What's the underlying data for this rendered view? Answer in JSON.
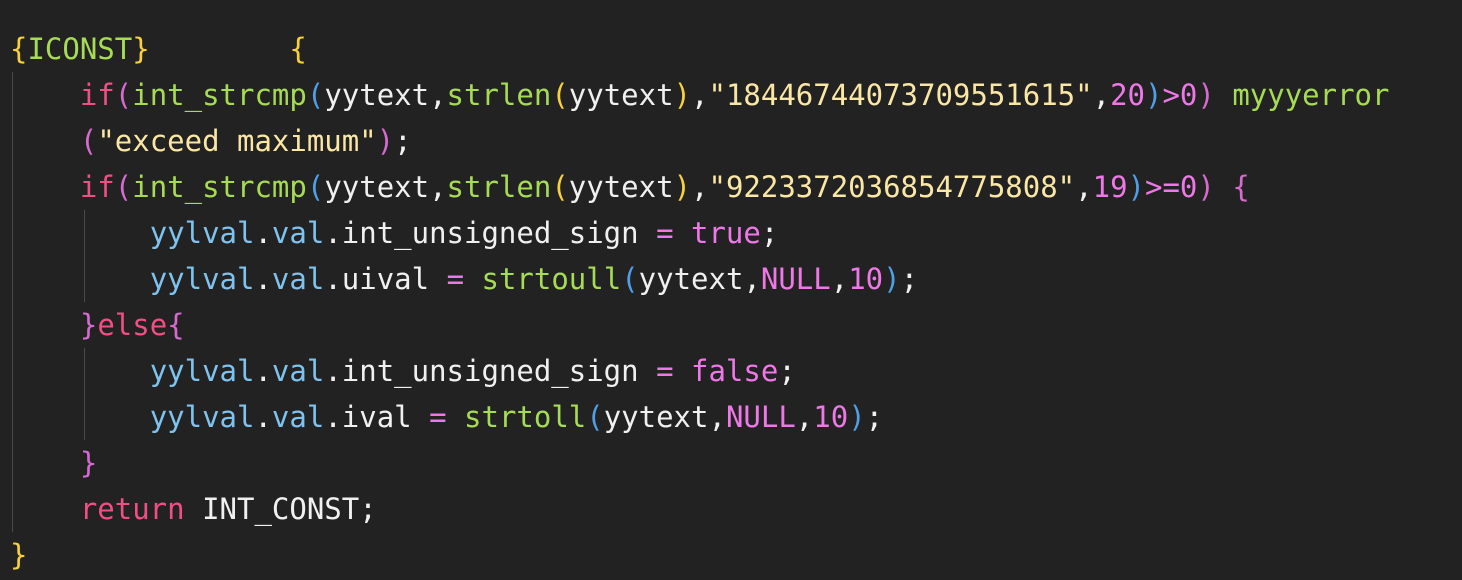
{
  "theme": {
    "background": "#222222",
    "plain": "#f0f0f0",
    "keyword": "#f14e84",
    "function": "#a6dc54",
    "string": "#fbe7a5",
    "number": "#ee78e7",
    "operator": "#ee78e7",
    "variable": "#7ec3f0",
    "identifier": "#f0f0f0",
    "brace_gold": "#f8d13a",
    "brace_pink": "#d66ad0",
    "brace_blue": "#4f9ee8",
    "rule_name": "#a6dc54"
  },
  "code_lines": [
    [
      {
        "t": "{",
        "c": "brace_gold"
      },
      {
        "t": "ICONST",
        "c": "rule_name"
      },
      {
        "t": "}",
        "c": "brace_gold"
      },
      {
        "t": "        ",
        "c": "plain"
      },
      {
        "t": "{",
        "c": "brace_gold"
      }
    ],
    [
      {
        "t": "    ",
        "c": "plain"
      },
      {
        "t": "if",
        "c": "keyword"
      },
      {
        "t": "(",
        "c": "brace_pink"
      },
      {
        "t": "int_strcmp",
        "c": "function"
      },
      {
        "t": "(",
        "c": "brace_blue"
      },
      {
        "t": "yytext",
        "c": "plain"
      },
      {
        "t": ",",
        "c": "plain"
      },
      {
        "t": "strlen",
        "c": "function"
      },
      {
        "t": "(",
        "c": "brace_gold"
      },
      {
        "t": "yytext",
        "c": "plain"
      },
      {
        "t": ")",
        "c": "brace_gold"
      },
      {
        "t": ",",
        "c": "plain"
      },
      {
        "t": "\"18446744073709551615\"",
        "c": "string"
      },
      {
        "t": ",",
        "c": "plain"
      },
      {
        "t": "20",
        "c": "number"
      },
      {
        "t": ")",
        "c": "brace_blue"
      },
      {
        "t": ">",
        "c": "operator"
      },
      {
        "t": "0",
        "c": "number"
      },
      {
        "t": ")",
        "c": "brace_pink"
      },
      {
        "t": " ",
        "c": "plain"
      },
      {
        "t": "myyyerror",
        "c": "function"
      }
    ],
    [
      {
        "t": "    ",
        "c": "plain"
      },
      {
        "t": "(",
        "c": "brace_pink"
      },
      {
        "t": "\"exceed maximum\"",
        "c": "string"
      },
      {
        "t": ")",
        "c": "brace_pink"
      },
      {
        "t": ";",
        "c": "plain"
      }
    ],
    [
      {
        "t": "    ",
        "c": "plain"
      },
      {
        "t": "if",
        "c": "keyword"
      },
      {
        "t": "(",
        "c": "brace_pink"
      },
      {
        "t": "int_strcmp",
        "c": "function"
      },
      {
        "t": "(",
        "c": "brace_blue"
      },
      {
        "t": "yytext",
        "c": "plain"
      },
      {
        "t": ",",
        "c": "plain"
      },
      {
        "t": "strlen",
        "c": "function"
      },
      {
        "t": "(",
        "c": "brace_gold"
      },
      {
        "t": "yytext",
        "c": "plain"
      },
      {
        "t": ")",
        "c": "brace_gold"
      },
      {
        "t": ",",
        "c": "plain"
      },
      {
        "t": "\"9223372036854775808\"",
        "c": "string"
      },
      {
        "t": ",",
        "c": "plain"
      },
      {
        "t": "19",
        "c": "number"
      },
      {
        "t": ")",
        "c": "brace_blue"
      },
      {
        "t": ">=",
        "c": "operator"
      },
      {
        "t": "0",
        "c": "number"
      },
      {
        "t": ")",
        "c": "brace_pink"
      },
      {
        "t": " ",
        "c": "plain"
      },
      {
        "t": "{",
        "c": "brace_pink"
      }
    ],
    [
      {
        "t": "        ",
        "c": "plain"
      },
      {
        "t": "yylval",
        "c": "variable"
      },
      {
        "t": ".",
        "c": "plain"
      },
      {
        "t": "val",
        "c": "variable"
      },
      {
        "t": ".",
        "c": "plain"
      },
      {
        "t": "int_unsigned_sign",
        "c": "plain"
      },
      {
        "t": " ",
        "c": "plain"
      },
      {
        "t": "=",
        "c": "operator"
      },
      {
        "t": " ",
        "c": "plain"
      },
      {
        "t": "true",
        "c": "number"
      },
      {
        "t": ";",
        "c": "plain"
      }
    ],
    [
      {
        "t": "        ",
        "c": "plain"
      },
      {
        "t": "yylval",
        "c": "variable"
      },
      {
        "t": ".",
        "c": "plain"
      },
      {
        "t": "val",
        "c": "variable"
      },
      {
        "t": ".",
        "c": "plain"
      },
      {
        "t": "uival",
        "c": "plain"
      },
      {
        "t": " ",
        "c": "plain"
      },
      {
        "t": "=",
        "c": "operator"
      },
      {
        "t": " ",
        "c": "plain"
      },
      {
        "t": "strtoull",
        "c": "function"
      },
      {
        "t": "(",
        "c": "brace_blue"
      },
      {
        "t": "yytext",
        "c": "plain"
      },
      {
        "t": ",",
        "c": "plain"
      },
      {
        "t": "NULL",
        "c": "number"
      },
      {
        "t": ",",
        "c": "plain"
      },
      {
        "t": "10",
        "c": "number"
      },
      {
        "t": ")",
        "c": "brace_blue"
      },
      {
        "t": ";",
        "c": "plain"
      }
    ],
    [
      {
        "t": "    ",
        "c": "plain"
      },
      {
        "t": "}",
        "c": "brace_pink"
      },
      {
        "t": "else",
        "c": "keyword"
      },
      {
        "t": "{",
        "c": "brace_pink"
      }
    ],
    [
      {
        "t": "        ",
        "c": "plain"
      },
      {
        "t": "yylval",
        "c": "variable"
      },
      {
        "t": ".",
        "c": "plain"
      },
      {
        "t": "val",
        "c": "variable"
      },
      {
        "t": ".",
        "c": "plain"
      },
      {
        "t": "int_unsigned_sign",
        "c": "plain"
      },
      {
        "t": " ",
        "c": "plain"
      },
      {
        "t": "=",
        "c": "operator"
      },
      {
        "t": " ",
        "c": "plain"
      },
      {
        "t": "false",
        "c": "number"
      },
      {
        "t": ";",
        "c": "plain"
      }
    ],
    [
      {
        "t": "        ",
        "c": "plain"
      },
      {
        "t": "yylval",
        "c": "variable"
      },
      {
        "t": ".",
        "c": "plain"
      },
      {
        "t": "val",
        "c": "variable"
      },
      {
        "t": ".",
        "c": "plain"
      },
      {
        "t": "ival",
        "c": "plain"
      },
      {
        "t": " ",
        "c": "plain"
      },
      {
        "t": "=",
        "c": "operator"
      },
      {
        "t": " ",
        "c": "plain"
      },
      {
        "t": "strtoll",
        "c": "function"
      },
      {
        "t": "(",
        "c": "brace_blue"
      },
      {
        "t": "yytext",
        "c": "plain"
      },
      {
        "t": ",",
        "c": "plain"
      },
      {
        "t": "NULL",
        "c": "number"
      },
      {
        "t": ",",
        "c": "plain"
      },
      {
        "t": "10",
        "c": "number"
      },
      {
        "t": ")",
        "c": "brace_blue"
      },
      {
        "t": ";",
        "c": "plain"
      }
    ],
    [
      {
        "t": "    ",
        "c": "plain"
      },
      {
        "t": "}",
        "c": "brace_pink"
      }
    ],
    [
      {
        "t": "    ",
        "c": "plain"
      },
      {
        "t": "return",
        "c": "keyword"
      },
      {
        "t": " ",
        "c": "plain"
      },
      {
        "t": "INT_CONST",
        "c": "plain"
      },
      {
        "t": ";",
        "c": "plain"
      }
    ],
    [
      {
        "t": "}",
        "c": "brace_gold"
      }
    ]
  ]
}
